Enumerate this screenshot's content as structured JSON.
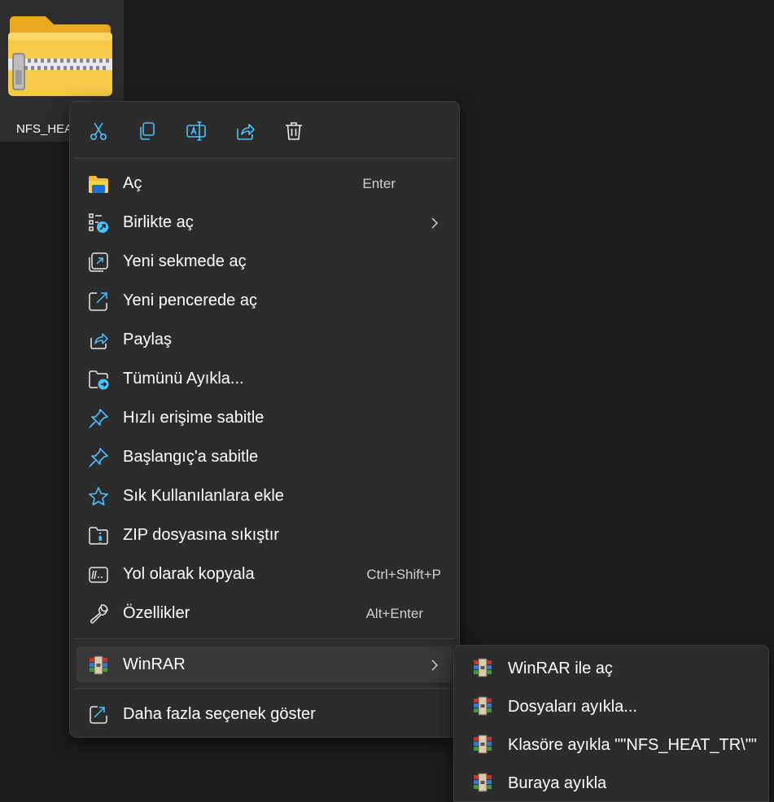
{
  "desktop": {
    "file_label": "NFS_HEA"
  },
  "toolbar": {
    "items": [
      {
        "icon": "cut-icon"
      },
      {
        "icon": "copy-icon"
      },
      {
        "icon": "rename-icon"
      },
      {
        "icon": "share-icon"
      },
      {
        "icon": "delete-icon"
      }
    ]
  },
  "menu": {
    "items": [
      {
        "label": "Aç",
        "shortcut": "Enter",
        "icon": "folder-open-icon"
      },
      {
        "label": "Birlikte aç",
        "shortcut": "",
        "icon": "open-with-icon",
        "submenu": true
      },
      {
        "label": "Yeni sekmede aç",
        "shortcut": "",
        "icon": "new-tab-icon"
      },
      {
        "label": "Yeni pencerede aç",
        "shortcut": "",
        "icon": "new-window-icon"
      },
      {
        "label": "Paylaş",
        "shortcut": "",
        "icon": "share-icon"
      },
      {
        "label": "Tümünü Ayıkla...",
        "shortcut": "",
        "icon": "extract-all-icon"
      },
      {
        "label": "Hızlı erişime sabitle",
        "shortcut": "",
        "icon": "pin-icon"
      },
      {
        "label": "Başlangıç'a sabitle",
        "shortcut": "",
        "icon": "pin-icon"
      },
      {
        "label": "Sık Kullanılanlara ekle",
        "shortcut": "",
        "icon": "star-icon"
      },
      {
        "label": "ZIP dosyasına sıkıştır",
        "shortcut": "",
        "icon": "zip-icon"
      },
      {
        "label": "Yol olarak kopyala",
        "shortcut": "Ctrl+Shift+P",
        "icon": "copy-path-icon"
      },
      {
        "label": "Özellikler",
        "shortcut": "Alt+Enter",
        "icon": "wrench-icon"
      }
    ],
    "winrar": {
      "label": "WinRAR",
      "icon": "winrar-icon"
    },
    "more": {
      "label": "Daha fazla seçenek göster",
      "icon": "more-options-icon"
    }
  },
  "submenu": {
    "items": [
      {
        "label": "WinRAR ile aç"
      },
      {
        "label": "Dosyaları ayıkla..."
      },
      {
        "label": "Klasöre ayıkla \"\"NFS_HEAT_TR\\\"\""
      },
      {
        "label": "Buraya ayıkla"
      }
    ]
  },
  "colors": {
    "accent": "#4cc2ff",
    "menu_bg": "#2c2c2c",
    "hover_bg": "#383838"
  }
}
